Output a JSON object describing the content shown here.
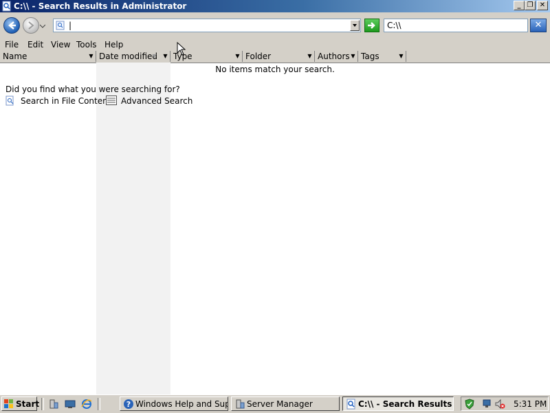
{
  "window": {
    "title": "C:\\\\ - Search Results in Administrator"
  },
  "address_bar": {
    "value": "|",
    "search_value": "C:\\\\"
  },
  "menu": {
    "items": [
      "File",
      "Edit",
      "View",
      "Tools",
      "Help"
    ]
  },
  "columns": [
    "Name",
    "Date modified",
    "Type",
    "Folder",
    "Authors",
    "Tags"
  ],
  "content": {
    "empty_message": "No items match your search.",
    "prompt": "Did you find what you were searching for?",
    "links": [
      "Search in File Contents",
      "Advanced Search"
    ]
  },
  "taskbar": {
    "start_label": "Start",
    "buttons": [
      "Windows Help and Support",
      "Server Manager",
      "C:\\\\ - Search Results i..."
    ],
    "clock": "5:31 PM"
  },
  "colors": {
    "titlebar": "#0a246a",
    "chrome": "#d4d0c8",
    "sorted_column": "#f2f2f2"
  }
}
